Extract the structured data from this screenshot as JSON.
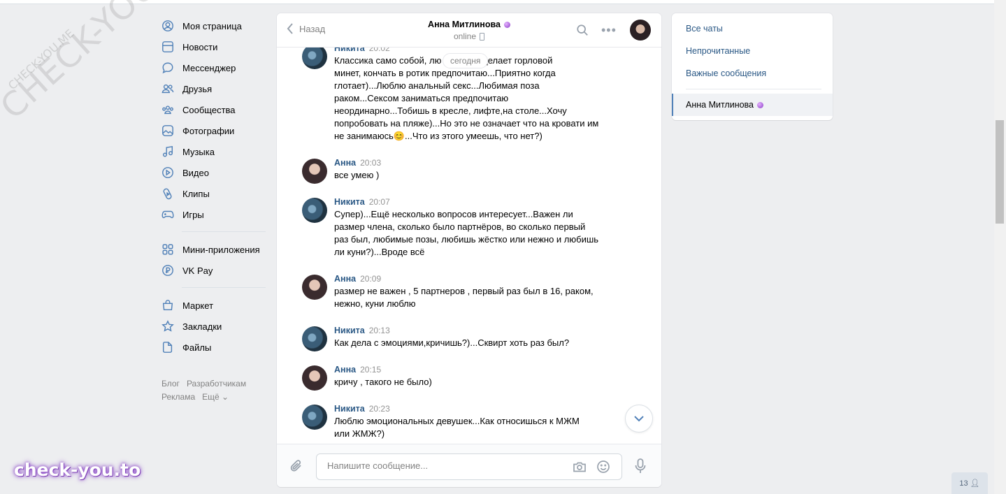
{
  "watermark": {
    "big": "CHECK-YOU.ME",
    "small": "CHECK-YOU.ME",
    "bottom": "check-you.to"
  },
  "nav": {
    "items": [
      {
        "label": "Моя страница",
        "icon": "user-circle-icon"
      },
      {
        "label": "Новости",
        "icon": "news-icon"
      },
      {
        "label": "Мессенджер",
        "icon": "message-icon"
      },
      {
        "label": "Друзья",
        "icon": "friends-icon"
      },
      {
        "label": "Сообщества",
        "icon": "groups-icon"
      },
      {
        "label": "Фотографии",
        "icon": "photo-icon"
      },
      {
        "label": "Музыка",
        "icon": "music-icon"
      },
      {
        "label": "Видео",
        "icon": "video-icon"
      },
      {
        "label": "Клипы",
        "icon": "clips-icon"
      },
      {
        "label": "Игры",
        "icon": "games-icon"
      }
    ],
    "items2": [
      {
        "label": "Мини-приложения",
        "icon": "apps-icon"
      },
      {
        "label": "VK Pay",
        "icon": "vkpay-icon"
      }
    ],
    "items3": [
      {
        "label": "Маркет",
        "icon": "market-icon"
      },
      {
        "label": "Закладки",
        "icon": "bookmark-icon"
      },
      {
        "label": "Файлы",
        "icon": "files-icon"
      }
    ],
    "footer": {
      "blog": "Блог",
      "dev": "Разработчикам",
      "ads": "Реклама",
      "more": "Ещё ⌄"
    }
  },
  "chat": {
    "back_label": "Назад",
    "peer_name": "Анна Митлинова",
    "peer_status": "online",
    "date_pill": "сегодня",
    "messages": [
      {
        "author": "Никита",
        "time": "20:02",
        "text": "Классика само собой, лю                 девушка делает горловой\nминет, кончать в ротик предпочитаю...Приятно когда\nглотает)...Люблю анальный секс...Любимая поза\nраком...Сексом заниматься предпочитаю\nнеординарно...Тобишь в кресле, лифте,на столе...Хочу\nпопробовать на пляже)...Но это не означает что на кровати им\nне занимаюсь😊...Что из этого умеешь, что нет?)"
      },
      {
        "author": "Анна",
        "time": "20:03",
        "text": "все умею )"
      },
      {
        "author": "Никита",
        "time": "20:07",
        "text": "Супер)...Ещё несколько вопросов интересует...Важен ли\nразмер члена, сколько было партнёров, во сколько первый\nраз был, любимые позы, любишь жёстко или нежно и любишь\nли куни?)...Вроде всё"
      },
      {
        "author": "Анна",
        "time": "20:09",
        "text": "размер не важен , 5 партнеров , первый раз был в 16, раком,\nнежно, куни люблю"
      },
      {
        "author": "Никита",
        "time": "20:13",
        "text": "Как дела с эмоциями,кричишь?)...Сквирт хоть раз был?"
      },
      {
        "author": "Анна",
        "time": "20:15",
        "text": "кричу , такого не было)"
      },
      {
        "author": "Никита",
        "time": "20:23",
        "text": "Люблю эмоциональных девушек...Как относишься к МЖМ\nили ЖМЖ?)"
      }
    ],
    "composer_placeholder": "Напишите сообщение..."
  },
  "right_menu": {
    "all_chats": "Все чаты",
    "unread": "Непрочитанные",
    "important": "Важные сообщения",
    "active_chat": "Анна Митлинова"
  },
  "online_count": "13"
}
